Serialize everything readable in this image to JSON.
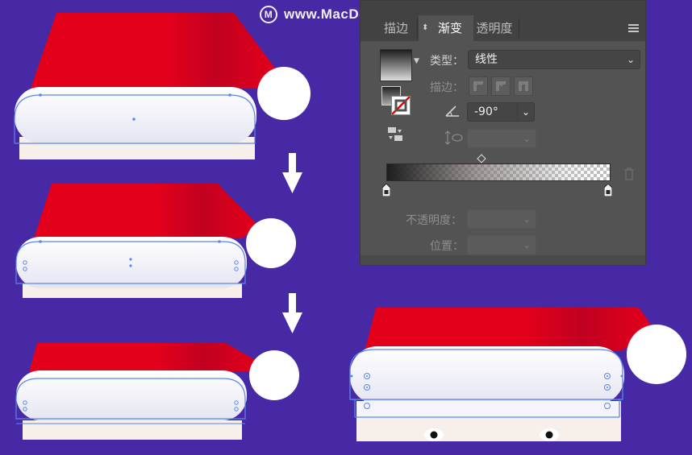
{
  "watermark": {
    "text": "www.MacDown.com"
  },
  "colors": {
    "background": "#4729a6",
    "hat_red": "#e3001b",
    "panel_bg": "#535353",
    "selection_blue": "#5a86f0"
  },
  "panel": {
    "tabs": [
      {
        "label": "描边",
        "active": false
      },
      {
        "label": "渐变",
        "active": true
      },
      {
        "label": "透明度",
        "active": false
      }
    ],
    "type_label": "类型：",
    "type_value": "线性",
    "stroke_label": "描边：",
    "angle_value": "-90°",
    "opacity_label": "不透明度：",
    "location_label": "位置："
  },
  "icons": {
    "menu": "menu-icon",
    "angle": "angle-icon",
    "aspect": "aspect-ratio-icon",
    "trash": "trash-icon",
    "reverse": "reverse-gradient-icon",
    "arrow": "down-arrow-icon"
  }
}
